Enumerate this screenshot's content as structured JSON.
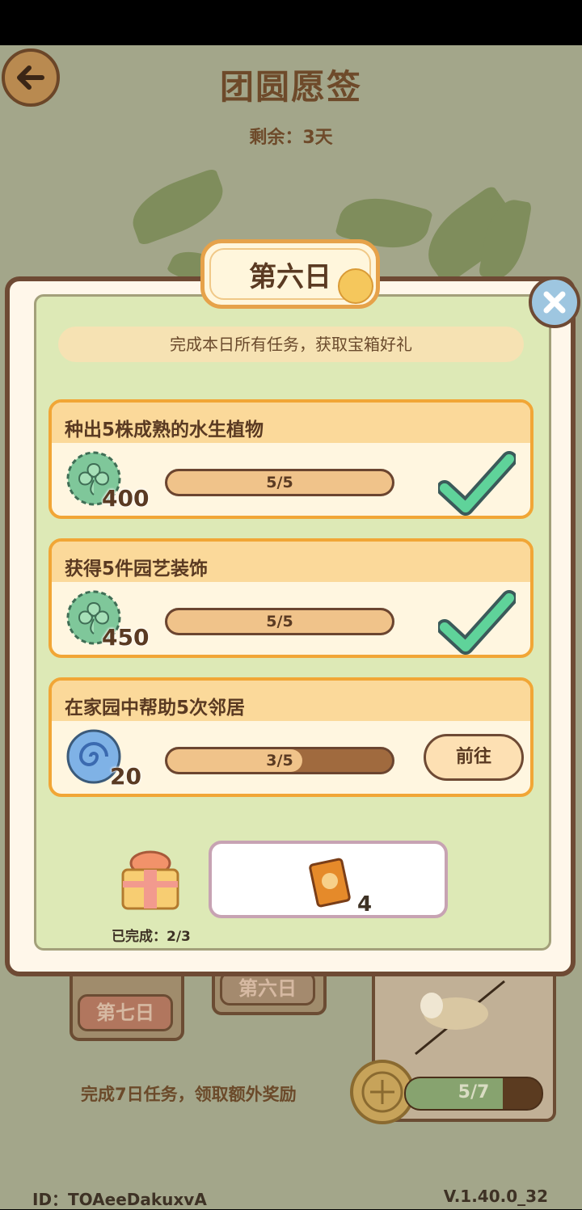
{
  "page": {
    "title": "团圆愿签",
    "remaining": "剩余：3天"
  },
  "background": {
    "cards": [
      {
        "label": "第七日"
      },
      {
        "label": "第六日"
      }
    ],
    "weekly_task": "完成7日任务，领取额外奖励",
    "weekly_progress": {
      "text": "5/7",
      "current": 5,
      "total": 7
    }
  },
  "footer": {
    "id": "ID：TOAeeDakuxvA",
    "version": "V.1.40.0_32"
  },
  "modal": {
    "day_title": "第六日",
    "subtitle": "完成本日所有任务，获取宝箱好礼",
    "tasks": [
      {
        "title": "种出5株成熟的水生植物",
        "reward_icon": "clover-coin-icon",
        "reward_amount": "400",
        "progress_text": "5/5",
        "current": 5,
        "total": 5,
        "status": "done"
      },
      {
        "title": "获得5件园艺装饰",
        "reward_icon": "clover-coin-icon",
        "reward_amount": "450",
        "progress_text": "5/5",
        "current": 5,
        "total": 5,
        "status": "done"
      },
      {
        "title": "在家园中帮助5次邻居",
        "reward_icon": "swirl-orb-icon",
        "reward_amount": "20",
        "progress_text": "3/5",
        "current": 3,
        "total": 5,
        "status": "in_progress",
        "action_label": "前往"
      }
    ],
    "completed_text": "已完成：2/3",
    "chest_reward": {
      "icon": "scroll-card-icon",
      "count": "4"
    }
  },
  "colors": {
    "accent_orange": "#f1a636",
    "check_green": "#5fd39a",
    "frame_brown": "#6e4a34"
  }
}
